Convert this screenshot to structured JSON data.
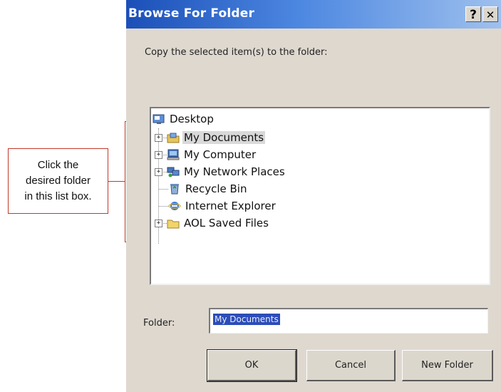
{
  "dialog": {
    "title": "Browse For Folder",
    "help_glyph": "?",
    "close_glyph": "✕",
    "instruction": "Copy the selected item(s) to the folder:",
    "tree": {
      "root": "Desktop",
      "items": [
        {
          "label": "My Documents",
          "icon": "my-documents-icon",
          "expandable": true,
          "selected": true
        },
        {
          "label": "My Computer",
          "icon": "my-computer-icon",
          "expandable": true,
          "selected": false
        },
        {
          "label": "My Network Places",
          "icon": "network-places-icon",
          "expandable": true,
          "selected": false
        },
        {
          "label": "Recycle Bin",
          "icon": "recycle-bin-icon",
          "expandable": false,
          "selected": false
        },
        {
          "label": "Internet Explorer",
          "icon": "internet-explorer-icon",
          "expandable": false,
          "selected": false
        },
        {
          "label": "AOL Saved Files",
          "icon": "folder-icon",
          "expandable": true,
          "selected": false
        }
      ]
    },
    "folder_label": "Folder:",
    "folder_value": "My Documents",
    "buttons": {
      "ok": "OK",
      "cancel": "Cancel",
      "new_folder": "New Folder"
    }
  },
  "callout": {
    "lines": [
      "Click the",
      "desired folder",
      "in this list box."
    ]
  },
  "colors": {
    "titlebar": "#1b4fb8",
    "selection": "#2c4db8",
    "callout_line": "#c0392b",
    "dialog_bg": "#ded8cf"
  }
}
